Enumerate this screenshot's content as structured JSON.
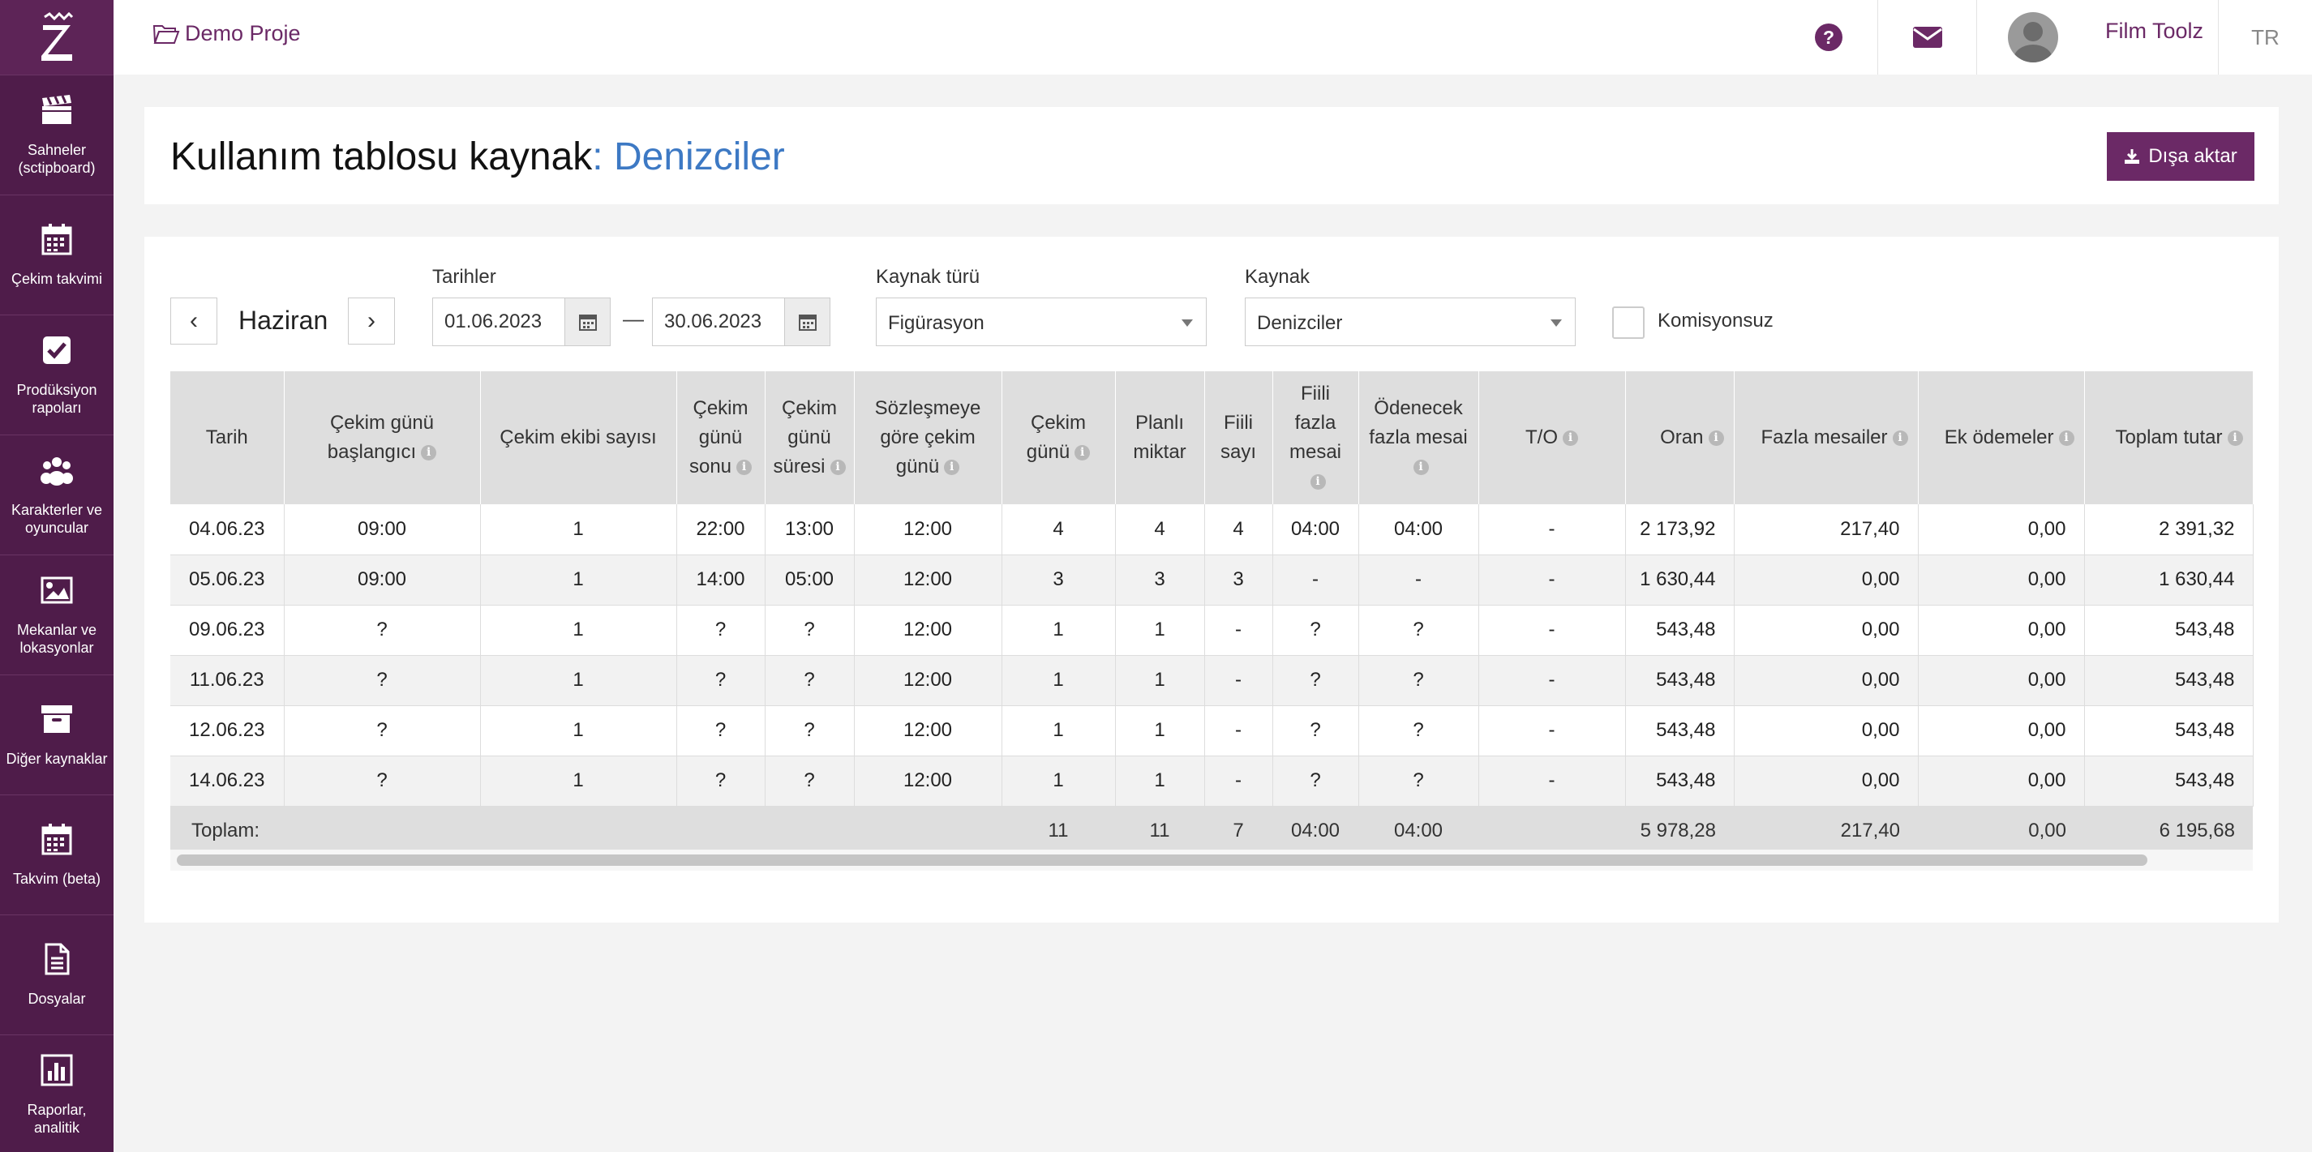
{
  "sidebar": {
    "items": [
      {
        "label": "Sahneler (sctipboard)",
        "icon": "clapperboard-icon"
      },
      {
        "label": "Çekim takvimi",
        "icon": "calendar-icon"
      },
      {
        "label": "Prodüksiyon rapoları",
        "icon": "checkbox-icon"
      },
      {
        "label": "Karakterler ve oyuncular",
        "icon": "users-icon"
      },
      {
        "label": "Mekanlar ve lokasyonlar",
        "icon": "image-icon"
      },
      {
        "label": "Diğer kaynaklar",
        "icon": "archive-icon"
      },
      {
        "label": "Takvim (beta)",
        "icon": "calendar-icon"
      },
      {
        "label": "Dosyalar",
        "icon": "file-icon"
      },
      {
        "label": "Raporlar, analitik",
        "icon": "bar-chart-icon"
      }
    ]
  },
  "topbar": {
    "project": "Demo Proje",
    "user_name": "Film Toolz",
    "language": "TR"
  },
  "header": {
    "title": "Kullanım tablosu kaynak",
    "separator": ":",
    "resource_name": "Denizciler",
    "export_label": "Dışa aktar"
  },
  "filters": {
    "month": "Haziran",
    "prev": "‹",
    "next": "›",
    "dates_label": "Tarihler",
    "date_from": "01.06.2023",
    "date_separator": "—",
    "date_to": "30.06.2023",
    "resource_type_label": "Kaynak türü",
    "resource_type": "Figürasyon",
    "resource_label": "Kaynak",
    "resource": "Denizciler",
    "no_commission_label": "Komisyonsuz"
  },
  "table": {
    "headers": [
      {
        "text": "Tarih",
        "info": false
      },
      {
        "text": "Çekim günü başlangıcı",
        "info": true
      },
      {
        "text": "Çekim ekibi sayısı",
        "info": false
      },
      {
        "text": "Çekim günü sonu",
        "info": true
      },
      {
        "text": "Çekim günü süresi",
        "info": true
      },
      {
        "text": "Sözleşmeye göre çekim günü",
        "info": true
      },
      {
        "text": "Çekim günü",
        "info": true
      },
      {
        "text": "Planlı miktar",
        "info": false
      },
      {
        "text": "Fiili sayı",
        "info": false
      },
      {
        "text": "Fiili fazla mesai",
        "info": true
      },
      {
        "text": "Ödenecek fazla mesai",
        "info": true
      },
      {
        "text": "T/O",
        "info": true
      },
      {
        "text": "Oran",
        "info": true
      },
      {
        "text": "Fazla mesailer",
        "info": true
      },
      {
        "text": "Ek ödemeler",
        "info": true
      },
      {
        "text": "Toplam tutar",
        "info": true
      }
    ],
    "rows": [
      [
        "04.06.23",
        "09:00",
        "1",
        "22:00",
        "13:00",
        "12:00",
        "4",
        "4",
        "4",
        "04:00",
        "04:00",
        "-",
        "2 173,92",
        "217,40",
        "0,00",
        "2 391,32"
      ],
      [
        "05.06.23",
        "09:00",
        "1",
        "14:00",
        "05:00",
        "12:00",
        "3",
        "3",
        "3",
        "-",
        "-",
        "-",
        "1 630,44",
        "0,00",
        "0,00",
        "1 630,44"
      ],
      [
        "09.06.23",
        "?",
        "1",
        "?",
        "?",
        "12:00",
        "1",
        "1",
        "-",
        "?",
        "?",
        "-",
        "543,48",
        "0,00",
        "0,00",
        "543,48"
      ],
      [
        "11.06.23",
        "?",
        "1",
        "?",
        "?",
        "12:00",
        "1",
        "1",
        "-",
        "?",
        "?",
        "-",
        "543,48",
        "0,00",
        "0,00",
        "543,48"
      ],
      [
        "12.06.23",
        "?",
        "1",
        "?",
        "?",
        "12:00",
        "1",
        "1",
        "-",
        "?",
        "?",
        "-",
        "543,48",
        "0,00",
        "0,00",
        "543,48"
      ],
      [
        "14.06.23",
        "?",
        "1",
        "?",
        "?",
        "12:00",
        "1",
        "1",
        "-",
        "?",
        "?",
        "-",
        "543,48",
        "0,00",
        "0,00",
        "543,48"
      ]
    ],
    "totals_label": "Toplam:",
    "totals": [
      "",
      "",
      "",
      "",
      "",
      "11",
      "11",
      "7",
      "04:00",
      "04:00",
      "",
      "5 978,28",
      "217,40",
      "0,00",
      "6 195,68"
    ]
  },
  "colors": {
    "sidebar": "#4f1c4a",
    "accent": "#6b2966",
    "link_blue": "#3d79c4"
  }
}
